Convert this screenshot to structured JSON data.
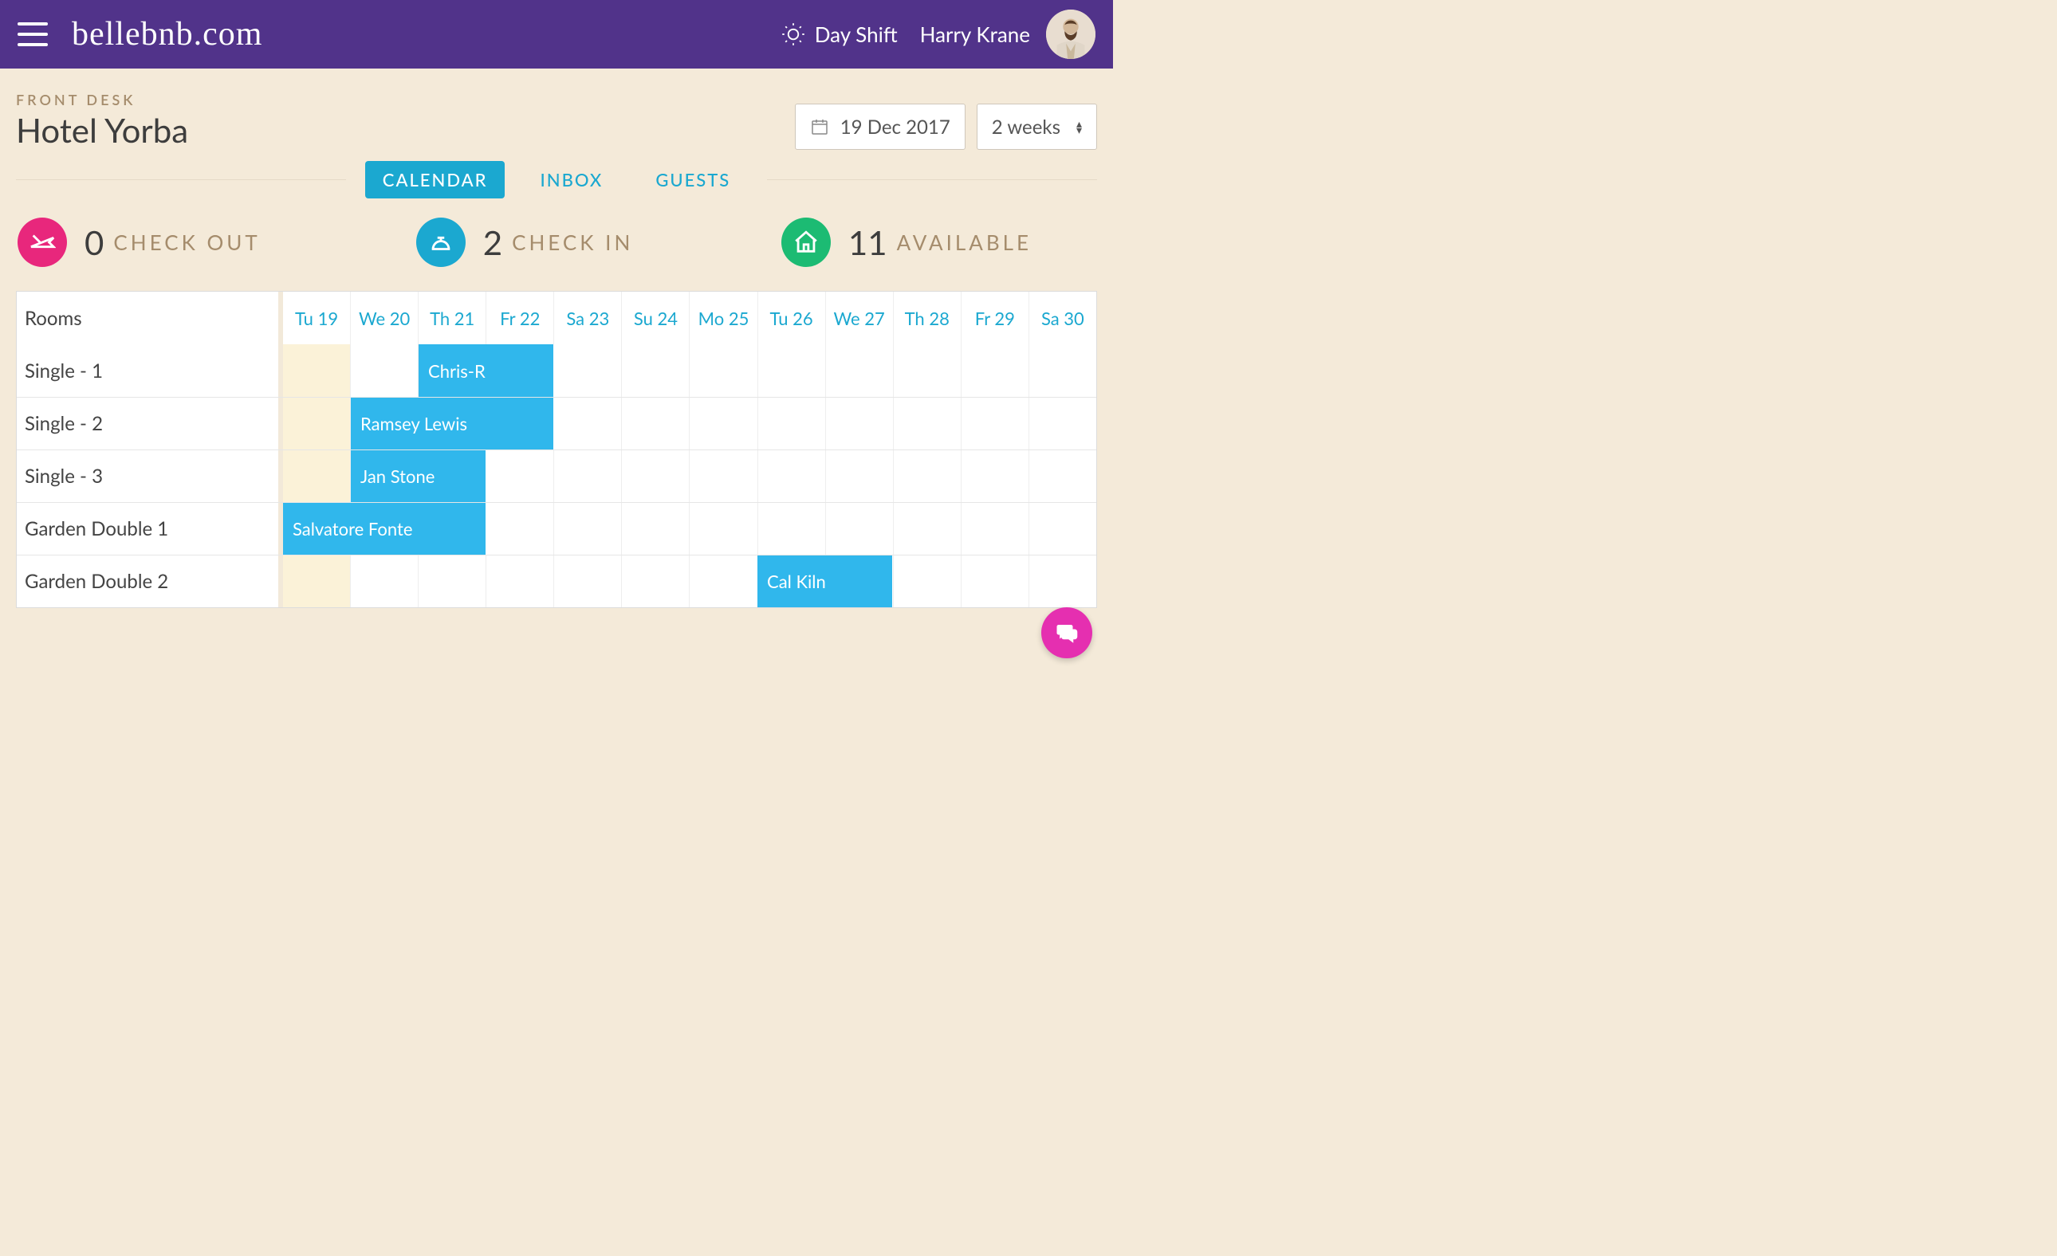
{
  "header": {
    "brand": "bellebnb.com",
    "shift_label": "Day Shift",
    "username": "Harry Krane"
  },
  "breadcrumb": "FRONT DESK",
  "hotel_name": "Hotel Yorba",
  "date_picker": {
    "value": "19 Dec 2017"
  },
  "range_picker": {
    "value": "2 weeks"
  },
  "tabs": {
    "calendar": "CALENDAR",
    "inbox": "INBOX",
    "guests": "GUESTS"
  },
  "stats": {
    "checkout": {
      "count": "0",
      "label": "CHECK OUT"
    },
    "checkin": {
      "count": "2",
      "label": "CHECK IN"
    },
    "available": {
      "count": "11",
      "label": "AVAILABLE"
    }
  },
  "calendar": {
    "rooms_header": "Rooms",
    "days": [
      "Tu 19",
      "We 20",
      "Th 21",
      "Fr 22",
      "Sa 23",
      "Su 24",
      "Mo 25",
      "Tu 26",
      "We 27",
      "Th 28",
      "Fr 29",
      "Sa 30"
    ],
    "today_index": 0,
    "rooms": [
      {
        "name": "Single - 1",
        "bookings": [
          {
            "guest": "Chris-R",
            "start": 2,
            "span": 2
          }
        ]
      },
      {
        "name": "Single - 2",
        "bookings": [
          {
            "guest": "Ramsey Lewis",
            "start": 1,
            "span": 3
          }
        ]
      },
      {
        "name": "Single - 3",
        "bookings": [
          {
            "guest": "Jan Stone",
            "start": 1,
            "span": 2
          }
        ]
      },
      {
        "name": "Garden Double 1",
        "bookings": [
          {
            "guest": "Salvatore Fonte",
            "start": 0,
            "span": 3
          }
        ]
      },
      {
        "name": "Garden Double 2",
        "bookings": [
          {
            "guest": "Cal Kiln",
            "start": 7,
            "span": 2
          }
        ]
      }
    ]
  }
}
